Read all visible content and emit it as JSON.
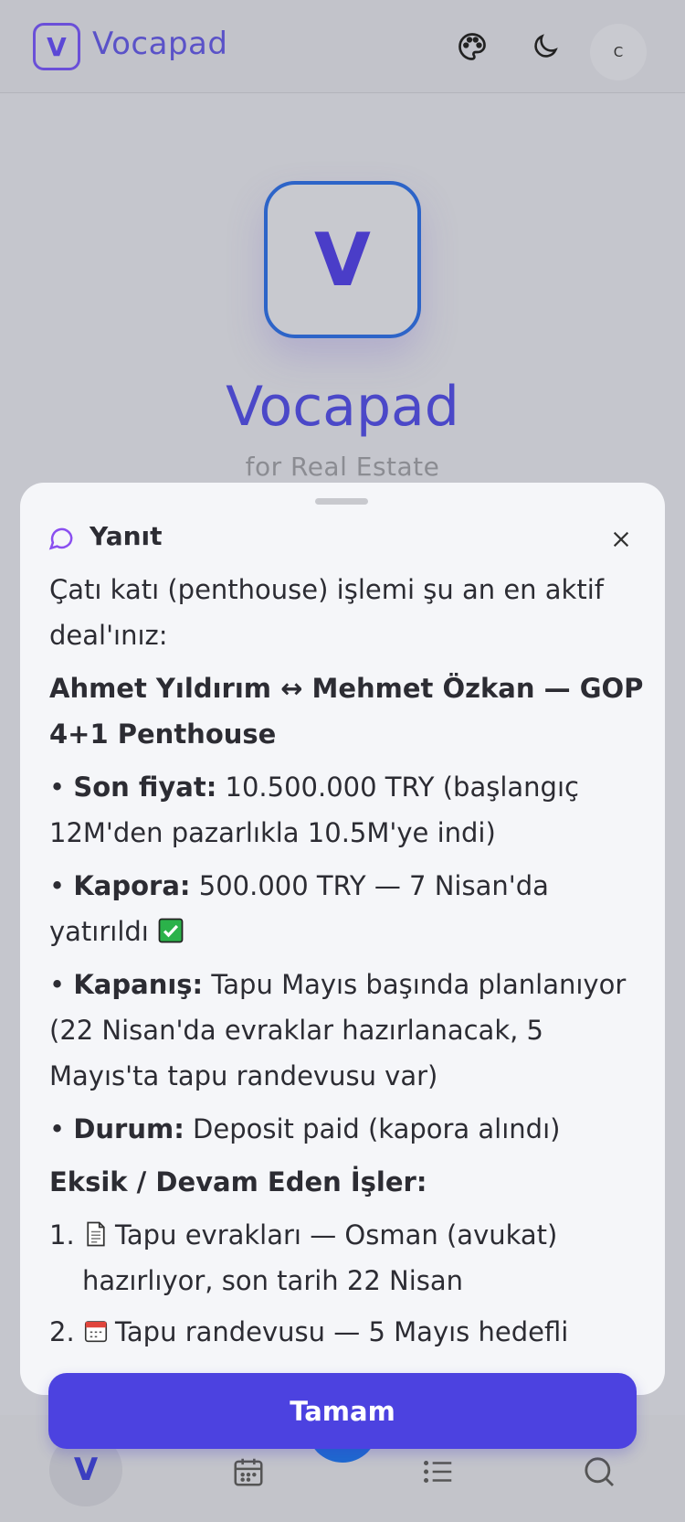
{
  "app": {
    "logo_letter": "V",
    "brand_name": "Vocapad",
    "hero_title": "Vocapad",
    "hero_subtitle": "for Real Estate",
    "avatar_initial": "C"
  },
  "icons": [
    "palette-icon",
    "moon-icon",
    "chat-icon",
    "close-icon",
    "calendar-icon",
    "list-icon",
    "search-icon"
  ],
  "colors": {
    "accent": "#4c42e0",
    "brand": "#5a52c8",
    "sheet_bg": "#f5f6f9"
  },
  "sheet": {
    "title": "Yanıt",
    "intro": "Çatı katı (penthouse) işlemi şu an en aktif deal'ınız:",
    "deal_title": "Ahmet Yıldırım ↔ Mehmet Özkan — GOP 4+1 Penthouse",
    "bullets": [
      {
        "label": "Son fiyat:",
        "text": " 10.500.000 TRY (başlangıç 12M'den pazarlıkla 10.5M'ye indi)"
      },
      {
        "label": "Kapora:",
        "text": " 500.000 TRY — 7 Nisan'da yatırıldı"
      },
      {
        "label": "Kapanış:",
        "text": " Tapu Mayıs başında planlanıyor (22 Nisan'da evraklar hazırlanacak, 5 Mayıs'ta tapu randevusu var)"
      },
      {
        "label": "Durum:",
        "text": " Deposit paid (kapora alındı)"
      }
    ],
    "section_title": "Eksik / Devam Eden İşler:",
    "tasks": [
      {
        "num": "1.",
        "text": "Tapu evrakları — Osman (avukat) hazırlıyor, son tarih 22 Nisan"
      },
      {
        "num": "2.",
        "text": "Tapu randevusu — 5 Mayıs hedefli"
      }
    ],
    "ok_label": "Tamam"
  }
}
